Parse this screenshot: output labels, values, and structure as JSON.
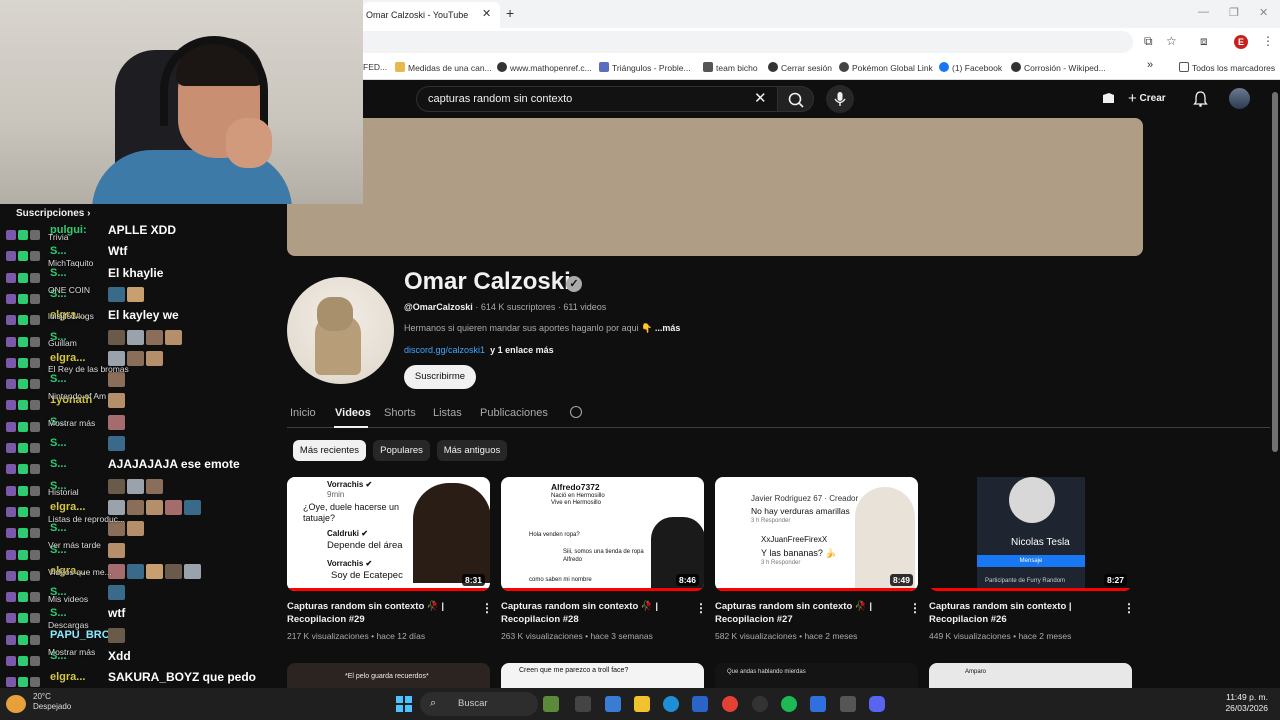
{
  "browser": {
    "tab_title": "Omar Calzoski - YouTube",
    "tab_close": "✕",
    "new_tab": "+",
    "profile_initial": "E",
    "bookmarks": [
      "FED...",
      "Medidas de una can...",
      "www.mathopenref.c...",
      "Triángulos - Proble...",
      "team bicho",
      "Cerrar sesión",
      "Pokémon Global Link",
      "(1) Facebook",
      "Corrosión - Wikiped...",
      "»",
      "Todos los marcadores"
    ]
  },
  "youtube": {
    "search_value": "capturas random sin contexto",
    "create_label": "Crear",
    "channel": {
      "name": "Omar Calzoski",
      "handle": "@OmarCalzoski",
      "subscribers": "614 K suscriptores",
      "videos_count": "611 videos",
      "description": "Hermanos si quieren mandar sus aportes haganlo por aqui 👇 ",
      "more": "...más",
      "link": "discord.gg/calzoski1",
      "more_links": "y 1 enlace más",
      "subscribe": "Suscribirme",
      "verified": "✓"
    },
    "tabs": [
      "Inicio",
      "Videos",
      "Shorts",
      "Listas",
      "Publicaciones"
    ],
    "chips": [
      "Más recientes",
      "Populares",
      "Más antiguos"
    ],
    "videos": [
      {
        "title": "Capturas random sin contexto 🥀 | Recopilacion #29",
        "views": "217 K visualizaciones",
        "age": "hace 12 días",
        "duration": "8:31",
        "progress": 1.0,
        "thumb": [
          "Vorrachis ✔",
          "9min",
          "¿Oye, duele hacerse un",
          "tatuaje?",
          "Caldruki ✔",
          "Depende del área",
          "Vorrachis ✔",
          "Soy de Ecatepec"
        ]
      },
      {
        "title": "Capturas random sin contexto 🥀 | Recopilacion #28",
        "views": "263 K visualizaciones",
        "age": "hace 3 semanas",
        "duration": "8:46",
        "progress": 1.0,
        "thumb": [
          "Alfredo7372",
          "Nació en Hermosillo",
          "Vive en Hermosillo",
          "Hola venden ropa?",
          "Siii, somos una tienda de ropa",
          "Alfredo",
          "como saben mi nombre"
        ]
      },
      {
        "title": "Capturas random sin contexto 🥀 | Recopilacion #27",
        "views": "582 K visualizaciones",
        "age": "hace 2 meses",
        "duration": "8:49",
        "progress": 1.0,
        "thumb": [
          "Javier Rodriguez 67 · Creador",
          "No hay verduras amarillas",
          "3 h   Responder",
          "XxJuanFreeFirexX",
          "Y las bananas? 🍌",
          "3 h   Responder"
        ]
      },
      {
        "title": "Capturas random sin contexto | Recopilacion #26",
        "views": "449 K visualizaciones",
        "age": "hace 2 meses",
        "duration": "8:27",
        "progress": 1.0,
        "thumb": [
          "Nicolas Tesla",
          "Mensaje",
          "Participante de Furry Random"
        ]
      }
    ],
    "row2_captions": [
      "*El pelo guarda recuerdos*",
      "Creen que me parezco a troll face?",
      "Que andas hablando mierdas",
      "Amparo"
    ]
  },
  "chat": {
    "subscriptions": "Suscripciones",
    "rows": [
      {
        "user": "pulgui:",
        "msg": "APLLE XDD",
        "color": "#2ecc71"
      },
      {
        "user": "S...",
        "msg": "Wtf",
        "color": "#2ecc71"
      },
      {
        "user": "S...",
        "msg": "El khaylie",
        "color": "#2ecc71"
      },
      {
        "user": "S...",
        "msg": "",
        "color": "#2ecc71"
      },
      {
        "user": "elgra...",
        "msg": "El kayley we",
        "color": "#d4c640"
      },
      {
        "user": "S...",
        "msg": "",
        "color": "#2ecc71"
      },
      {
        "user": "elgra...",
        "msg": "",
        "color": "#d4c640"
      },
      {
        "user": "S...",
        "msg": "",
        "color": "#2ecc71"
      },
      {
        "user": "1yonath",
        "msg": "",
        "color": "#d4c640"
      },
      {
        "user": "S...",
        "msg": "",
        "color": "#2ecc71"
      },
      {
        "user": "S...",
        "msg": "",
        "color": "#2ecc71"
      },
      {
        "user": "S...",
        "msg": "AJAJAJAJA ese emote",
        "color": "#2ecc71"
      },
      {
        "user": "S...",
        "msg": "",
        "color": "#2ecc71"
      },
      {
        "user": "elgra...",
        "msg": "",
        "color": "#d4c640"
      },
      {
        "user": "S...",
        "msg": "",
        "color": "#2ecc71"
      },
      {
        "user": "S...",
        "msg": "",
        "color": "#2ecc71"
      },
      {
        "user": "elgra...",
        "msg": "",
        "color": "#d4c640"
      },
      {
        "user": "S...",
        "msg": "",
        "color": "#2ecc71"
      },
      {
        "user": "S...",
        "msg": "wtf",
        "color": "#2ecc71"
      },
      {
        "user": "PAPU_BRO",
        "msg": "",
        "color": "#8be9fd"
      },
      {
        "user": "S...",
        "msg": "Xdd",
        "color": "#2ecc71"
      },
      {
        "user": "elgra...",
        "msg": "SAKURA_BOYZ que pedo",
        "color": "#d4c640"
      },
      {
        "user": "PAPU_BRO",
        "msg": "",
        "color": "#8be9fd"
      }
    ],
    "side_labels": [
      "Trivia",
      "MichTaquito",
      "ONE COIN",
      "luisjifs1/logs",
      "Guillam",
      "El Rey de las bromas",
      "Nintendo of Am",
      "Mostrar más",
      "Historial",
      "Listas de reproduc...",
      "Ver más tarde",
      "Videos que me...",
      "Mis videos",
      "Descargas",
      "Mostrar más"
    ]
  },
  "taskbar": {
    "search": "Buscar",
    "weather_temp": "20°C",
    "weather_desc": "Despejado",
    "time": "11:49 p. m.",
    "date": "26/03/2026"
  }
}
